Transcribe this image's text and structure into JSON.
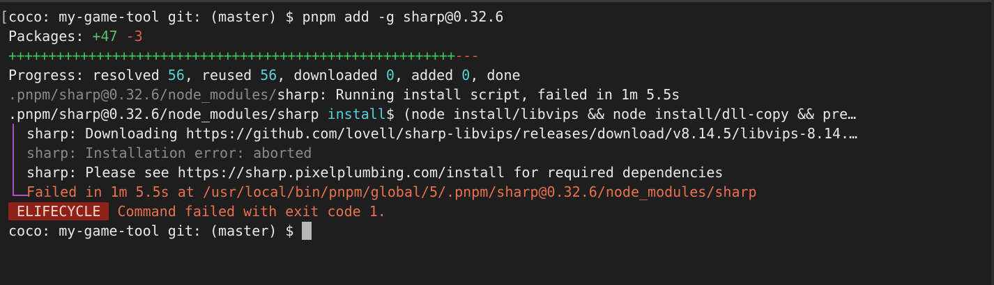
{
  "terminal": {
    "left_bracket": "[",
    "line1": {
      "prompt": "coco: my-game-tool git: (master) $ ",
      "command": "pnpm add -g sharp@0.32.6"
    },
    "line2": {
      "label": "Packages: ",
      "added": "+47",
      "space": " ",
      "removed": "-3"
    },
    "line3": {
      "plus_bar": "++++++++++++++++++++++++++++++++++++++++++++++++++++++++",
      "minus_bar": "---"
    },
    "line4": {
      "p1": "Progress: resolved ",
      "resolved": "56",
      "p2": ", reused ",
      "reused": "56",
      "p3": ", downloaded ",
      "downloaded": "0",
      "p4": ", added ",
      "added": "0",
      "p5": ", done"
    },
    "line5": {
      "path": ".pnpm/sharp@0.32.6/node_modules/",
      "rest": "sharp: Running install script, failed in 1m 5.5s"
    },
    "line6": {
      "path": ".pnpm/sharp@0.32.6/node_modules/sharp ",
      "keyword": "install",
      "rest": "$ (node install/libvips && node install/dll-copy && pre…"
    },
    "line7": "sharp: Downloading https://github.com/lovell/sharp-libvips/releases/download/v8.14.5/libvips-8.14.…",
    "line8": "sharp: Installation error: aborted",
    "line9": "sharp: Please see https://sharp.pixelplumbing.com/install for required dependencies",
    "line10": "Failed in 1m 5.5s at /usr/local/bin/pnpm/global/5/.pnpm/sharp@0.32.6/node_modules/sharp",
    "line11": {
      "badge": "ELIFECYCLE",
      "message": " Command failed with exit code 1."
    },
    "line12": {
      "prompt": "coco: my-game-tool git: (master) $ "
    }
  }
}
